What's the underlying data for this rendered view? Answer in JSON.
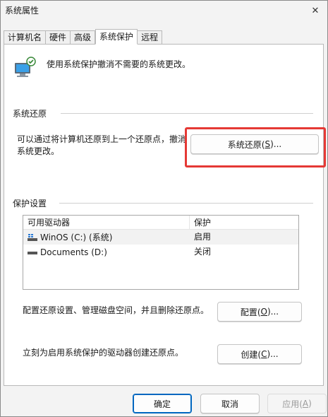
{
  "window": {
    "title": "系统属性"
  },
  "tabs": [
    {
      "label": "计算机名"
    },
    {
      "label": "硬件"
    },
    {
      "label": "高级"
    },
    {
      "label": "系统保护"
    },
    {
      "label": "远程"
    }
  ],
  "active_tab": "系统保护",
  "header": {
    "text": "使用系统保护撤消不需要的系统更改。"
  },
  "restore": {
    "group_label": "系统还原",
    "description": "可以通过将计算机还原到上一个还原点，撤消系统更改。",
    "button_prefix": "系统还原(",
    "button_key": "S",
    "button_suffix": ")..."
  },
  "protection": {
    "group_label": "保护设置",
    "columns": [
      "可用驱动器",
      "保护"
    ],
    "rows": [
      {
        "drive": "WinOS (C:) (系统)",
        "status": "启用",
        "icon": "windows-drive-icon"
      },
      {
        "drive": "Documents (D:)",
        "status": "关闭",
        "icon": "drive-icon"
      }
    ],
    "configure_text": "配置还原设置、管理磁盘空间，并且删除还原点。",
    "configure_prefix": "配置(",
    "configure_key": "O",
    "configure_suffix": ")...",
    "create_text": "立刻为启用系统保护的驱动器创建还原点。",
    "create_prefix": "创建(",
    "create_key": "C",
    "create_suffix": ")..."
  },
  "footer": {
    "ok": "确定",
    "cancel": "取消",
    "apply_prefix": "应用(",
    "apply_key": "A",
    "apply_suffix": ")"
  },
  "colors": {
    "highlight": "#e53935",
    "accent": "#0067c0"
  }
}
